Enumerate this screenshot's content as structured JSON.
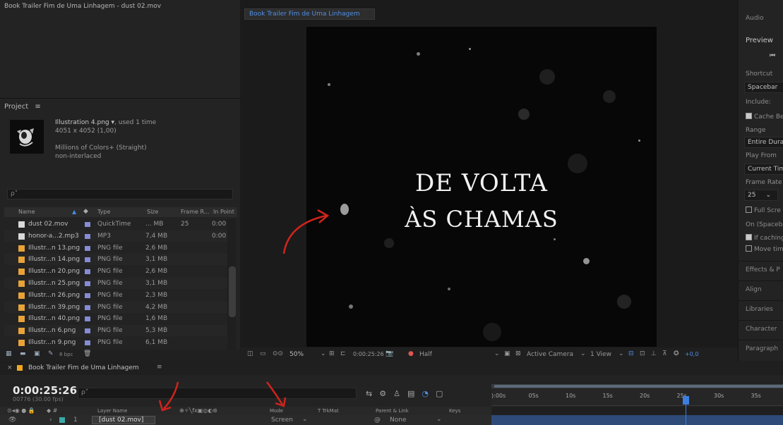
{
  "left_top": {
    "title": "Book Trailer Fim de Uma Linhagem - dust 02.mov"
  },
  "project": {
    "header": "Project",
    "menu_icon": "≡",
    "file_name": "Illustration 4.png",
    "used": ", used 1 time",
    "dimensions": "4051 x 4052 (1,00)",
    "color": "Millions of Colors+ (Straight)",
    "interlace": "non-interlaced",
    "search_placeholder": "ρ˅",
    "columns": [
      "Name",
      "Type",
      "Size",
      "Frame R...",
      "In Point"
    ],
    "rows": [
      {
        "name": "dust 02.mov",
        "type": "QuickTime",
        "size": "... MB",
        "fr": "25",
        "in": "0:00"
      },
      {
        "name": "honor-a...2.mp3",
        "type": "MP3",
        "size": "7,4 MB",
        "fr": "",
        "in": "0:00"
      },
      {
        "name": "Illustr...n 13.png",
        "type": "PNG file",
        "size": "2,6 MB",
        "fr": "",
        "in": ""
      },
      {
        "name": "Illustr...n 14.png",
        "type": "PNG file",
        "size": "3,1 MB",
        "fr": "",
        "in": ""
      },
      {
        "name": "Illustr...n 20.png",
        "type": "PNG file",
        "size": "2,6 MB",
        "fr": "",
        "in": ""
      },
      {
        "name": "Illustr...n 25.png",
        "type": "PNG file",
        "size": "3,1 MB",
        "fr": "",
        "in": ""
      },
      {
        "name": "Illustr...n 26.png",
        "type": "PNG file",
        "size": "2,3 MB",
        "fr": "",
        "in": ""
      },
      {
        "name": "Illustr...n 39.png",
        "type": "PNG file",
        "size": "4,2 MB",
        "fr": "",
        "in": ""
      },
      {
        "name": "Illustr...n 40.png",
        "type": "PNG file",
        "size": "1,6 MB",
        "fr": "",
        "in": ""
      },
      {
        "name": "Illustr...n 6.png",
        "type": "PNG file",
        "size": "5,3 MB",
        "fr": "",
        "in": ""
      },
      {
        "name": "Illustr...n 9.png",
        "type": "PNG file",
        "size": "6,1 MB",
        "fr": "",
        "in": ""
      }
    ],
    "bpc": "8 bpc"
  },
  "viewer": {
    "comp_tab": "Book Trailer Fim de Uma Linhagem",
    "title_line1": "DE VOLTA",
    "title_line2": "ÀS CHAMAS",
    "zoom": "50%",
    "timecode": "0:00:25:26",
    "resolution": "Half",
    "camera": "Active Camera",
    "view": "1 View",
    "exposure": "+0,0"
  },
  "right_panel": {
    "audio": "Audio",
    "preview": "Preview",
    "shortcut_label": "Shortcut",
    "shortcut_value": "Spacebar",
    "include_label": "Include:",
    "cache_label": "Cache Be",
    "range_label": "Range",
    "range_value": "Entire Dura",
    "play_from_label": "Play From",
    "play_from_value": "Current Tim",
    "frame_rate_label": "Frame Rate",
    "frame_rate_value": "25",
    "full_screen": "Full Scre",
    "on_spacebar": "On (Spacebar",
    "if_caching": "If caching",
    "move_time": "Move tim",
    "effects": "Effects & P",
    "align": "Align",
    "libraries": "Libraries",
    "character": "Character",
    "paragraph": "Paragraph"
  },
  "timeline": {
    "comp_name": "Book Trailer Fim de Uma Linhagem",
    "timecode": "0:00:25:26",
    "fps": "00776 (30.00 fps)",
    "ruler": [
      "0s",
      "05s",
      "10s",
      "15s",
      "20s",
      "25s",
      "30s",
      "35s"
    ],
    "ruler_start": "):00s",
    "col_layer_name": "Layer Name",
    "col_mode": "Mode",
    "col_trkmat": "T  TrkMat",
    "col_parent": "Parent & Link",
    "col_keys": "Keys",
    "layer_num": "1",
    "layer_name": "[dust 02.mov]",
    "layer_mode": "Screen",
    "layer_parent": "None"
  },
  "colors": {
    "accent": "#3d7ee0",
    "label_yellow": "#f2a81d",
    "arrow_red": "#d0241c"
  }
}
